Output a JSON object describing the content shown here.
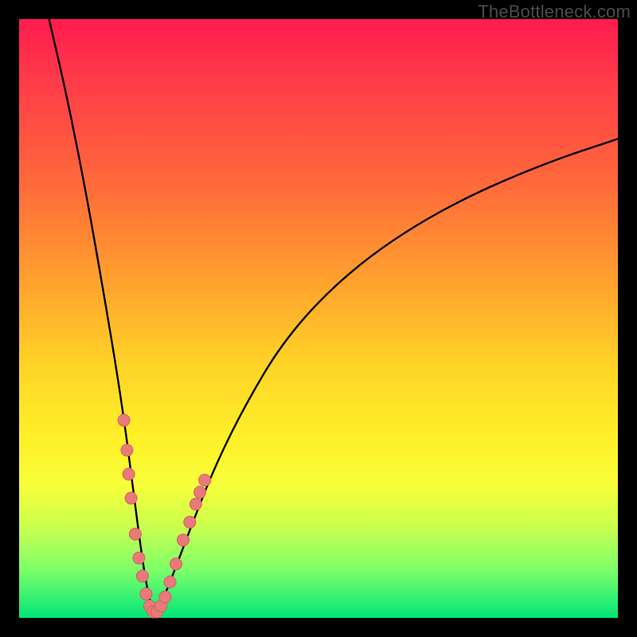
{
  "watermark": "TheBottleneck.com",
  "colors": {
    "background": "#000000",
    "curve_stroke": "#000000",
    "marker_fill": "#e87a7a",
    "marker_stroke": "#d46060"
  },
  "chart_data": {
    "type": "line",
    "title": "",
    "xlabel": "",
    "ylabel": "",
    "xlim": [
      0,
      100
    ],
    "ylim": [
      0,
      100
    ],
    "grid": false,
    "legend": false,
    "description": "V-shaped bottleneck curve with minimum around x≈22; curve departs from top near x≈5, reaches ~0 at x≈22, then rises back toward ~80 at the right edge.",
    "series": [
      {
        "name": "bottleneck-curve",
        "x": [
          5,
          8,
          11,
          14,
          17,
          19,
          20,
          21,
          22,
          23,
          24,
          26,
          29,
          33,
          38,
          44,
          52,
          62,
          74,
          88,
          100
        ],
        "y": [
          100,
          87,
          72,
          55,
          37,
          22,
          14,
          7,
          2,
          1,
          3,
          8,
          16,
          26,
          36,
          46,
          55,
          63,
          70,
          76,
          80
        ]
      }
    ],
    "markers": {
      "name": "highlight-dots",
      "color": "#e87a7a",
      "points": [
        {
          "x": 17.5,
          "y": 33
        },
        {
          "x": 18.0,
          "y": 28
        },
        {
          "x": 18.3,
          "y": 24
        },
        {
          "x": 18.7,
          "y": 20
        },
        {
          "x": 19.4,
          "y": 14
        },
        {
          "x": 20.0,
          "y": 10
        },
        {
          "x": 20.6,
          "y": 7
        },
        {
          "x": 21.2,
          "y": 4
        },
        {
          "x": 21.8,
          "y": 2
        },
        {
          "x": 22.4,
          "y": 1
        },
        {
          "x": 23.0,
          "y": 1
        },
        {
          "x": 23.7,
          "y": 2
        },
        {
          "x": 24.4,
          "y": 3.5
        },
        {
          "x": 25.2,
          "y": 6
        },
        {
          "x": 26.2,
          "y": 9
        },
        {
          "x": 27.4,
          "y": 13
        },
        {
          "x": 28.5,
          "y": 16
        },
        {
          "x": 29.5,
          "y": 19
        },
        {
          "x": 30.2,
          "y": 21
        },
        {
          "x": 31.0,
          "y": 23
        }
      ]
    }
  }
}
